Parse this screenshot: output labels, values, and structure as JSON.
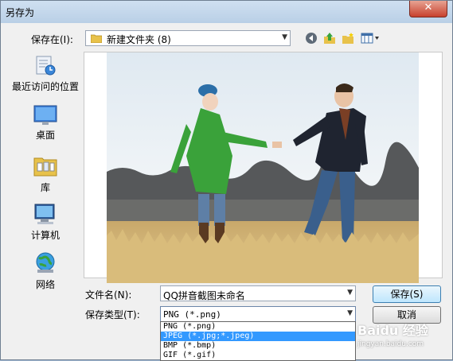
{
  "title": "另存为",
  "close_symbol": "✕",
  "save_in": {
    "label": "保存在(I):",
    "folder": "新建文件夹 (8)"
  },
  "toolbar": [
    "back-icon",
    "up-folder-icon",
    "new-folder-icon",
    "view-menu-icon"
  ],
  "places": [
    {
      "label": "最近访问的位置",
      "icon": "recent-places-icon"
    },
    {
      "label": "桌面",
      "icon": "desktop-icon"
    },
    {
      "label": "库",
      "icon": "libraries-icon"
    },
    {
      "label": "计算机",
      "icon": "computer-icon"
    },
    {
      "label": "网络",
      "icon": "network-icon"
    }
  ],
  "file_name": {
    "label": "文件名(N):",
    "value": "QQ拼音截图未命名"
  },
  "file_type": {
    "label": "保存类型(T):",
    "value": "PNG (*.png)",
    "options": [
      "PNG (*.png)",
      "JPEG (*.jpg;*.jpeg)",
      "BMP (*.bmp)",
      "GIF (*.gif)"
    ],
    "selected_index": 1
  },
  "buttons": {
    "save": "保存(S)",
    "cancel": "取消"
  },
  "watermark": {
    "logo": "Baidu 经验",
    "url": "jingyan.baidu.com"
  }
}
